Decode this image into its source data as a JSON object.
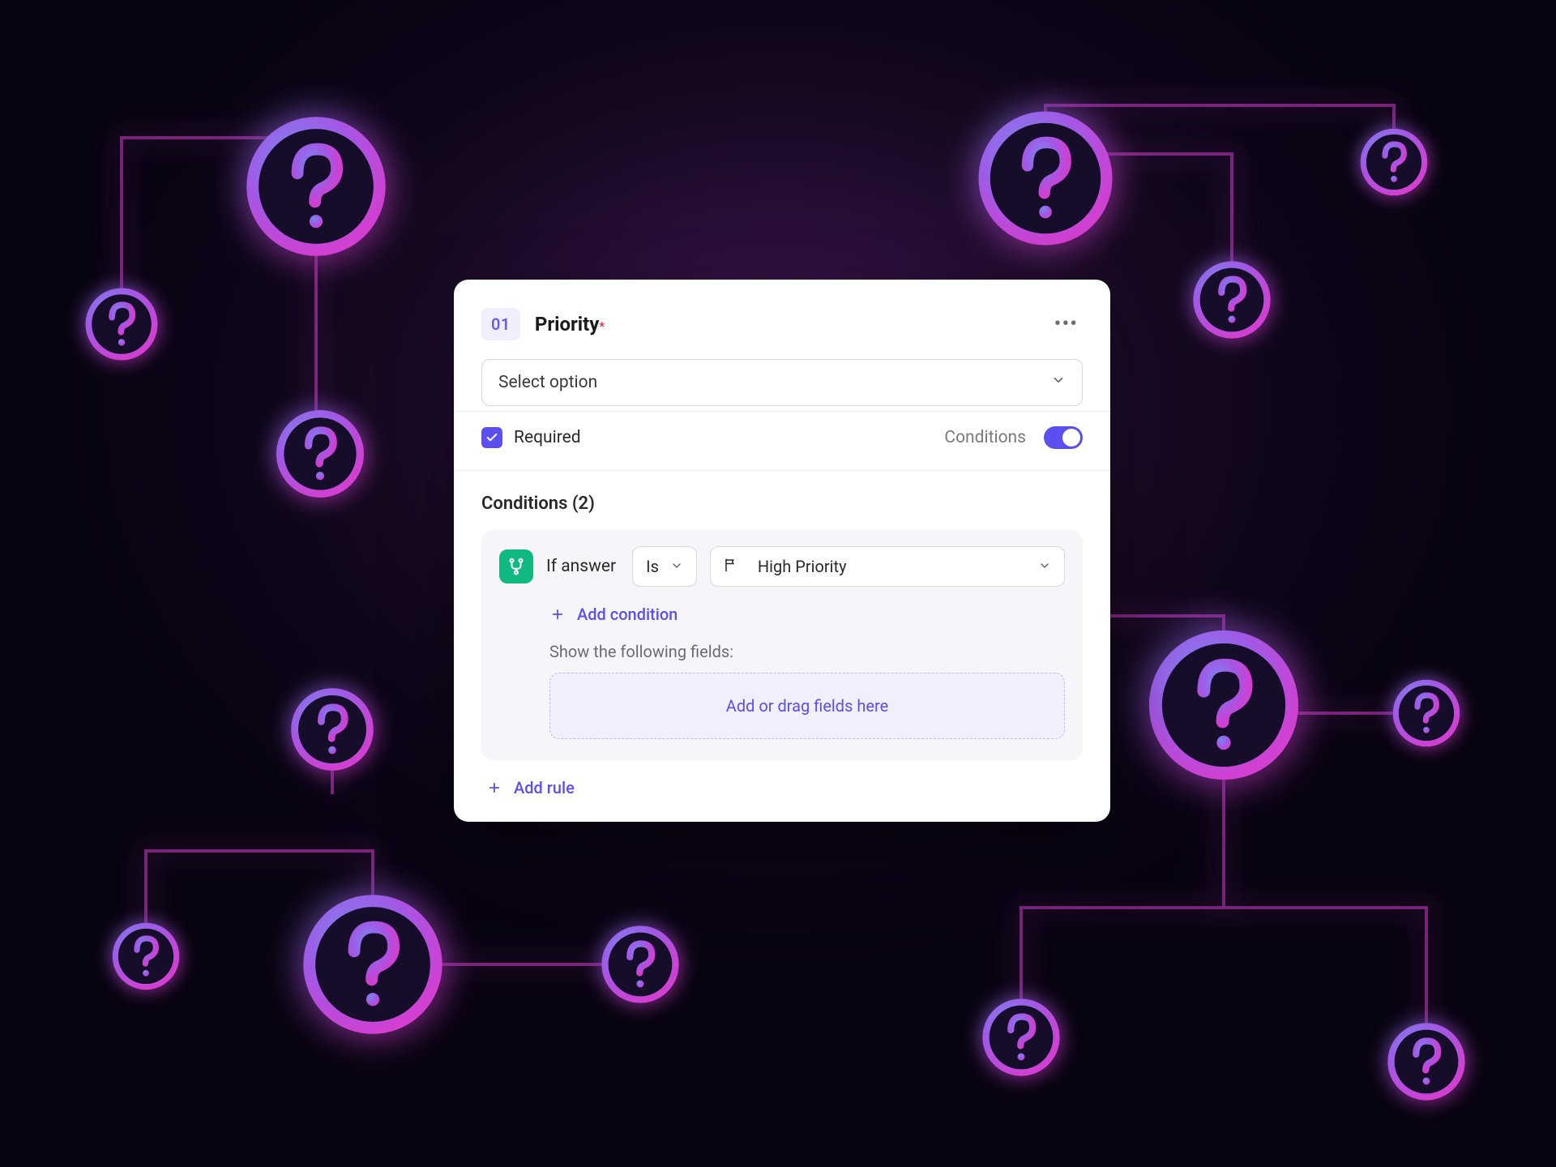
{
  "field": {
    "number": "01",
    "title": "Priority",
    "required_marker": "*",
    "select_placeholder": "Select option",
    "required_label": "Required",
    "required_checked": true,
    "conditions_label": "Conditions",
    "conditions_enabled": true
  },
  "conditions": {
    "heading": "Conditions (2)",
    "rule": {
      "if_label": "If answer",
      "operator": "Is",
      "value": "High Priority",
      "add_condition_label": "Add condition",
      "show_fields_label": "Show the following fields:",
      "dropzone_label": "Add or drag fields here"
    },
    "add_rule_label": "Add rule"
  },
  "colors": {
    "accent": "#5b4ff0",
    "success": "#10b981",
    "danger": "#e11d48"
  }
}
